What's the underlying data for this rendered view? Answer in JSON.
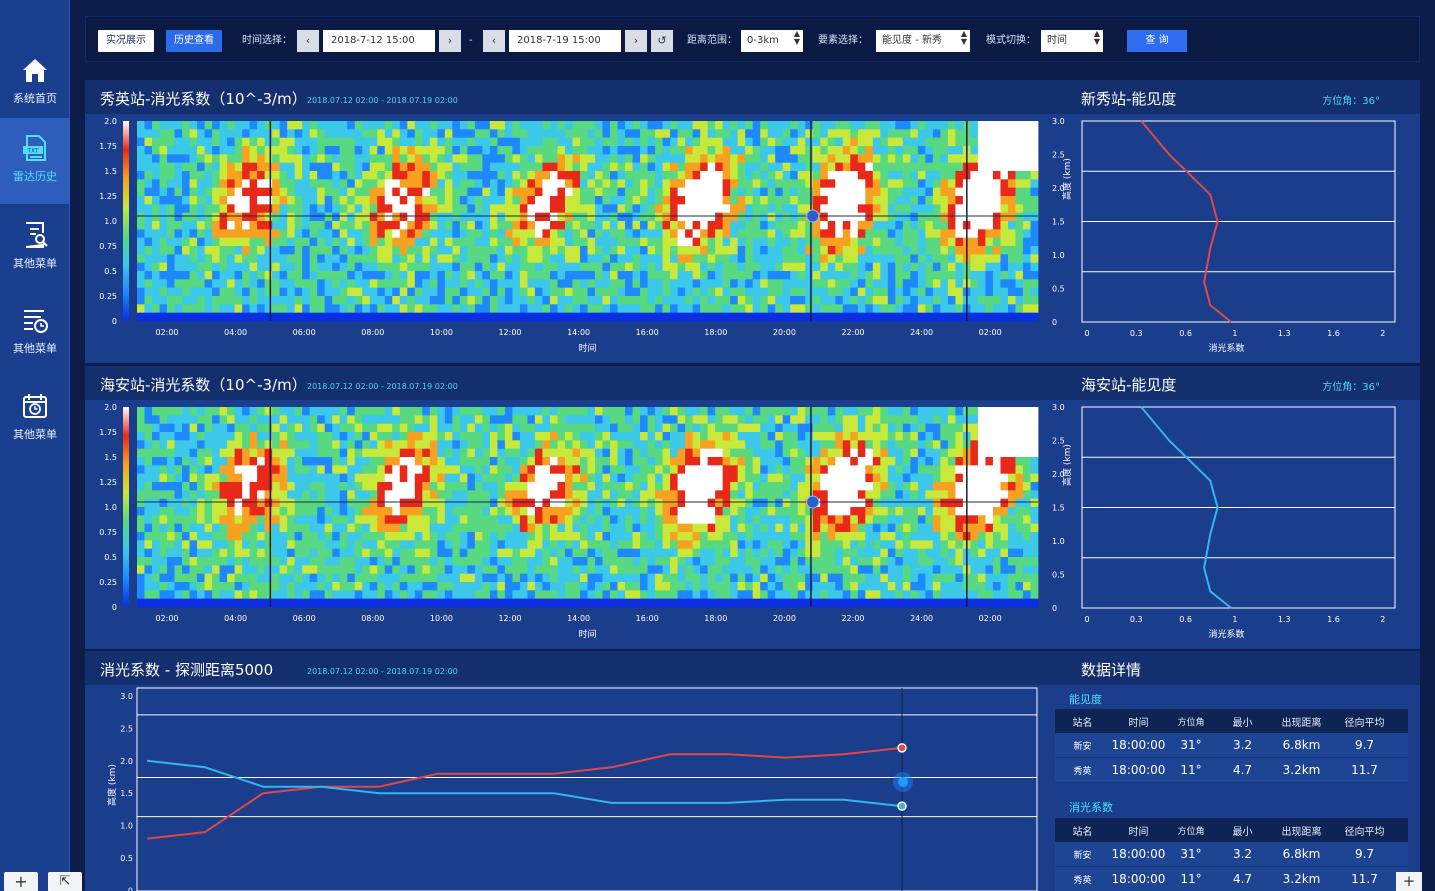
{
  "sidebar": {
    "items": [
      {
        "label": "系统首页",
        "icon": "home-icon"
      },
      {
        "label": "雷达历史",
        "icon": "txt-doc-icon"
      },
      {
        "label": "其他菜单",
        "icon": "doc-search-icon"
      },
      {
        "label": "其他菜单",
        "icon": "list-clock-icon"
      },
      {
        "label": "其他菜单",
        "icon": "calendar-clock-icon"
      }
    ],
    "active_index": 1,
    "bottom_plus": "+",
    "bottom_share": "⇱"
  },
  "toolbar": {
    "tab_live": "实况展示",
    "tab_history": "历史查看",
    "time_label": "时间选择：",
    "start_time": "2018-7-12 15:00",
    "dash": "-",
    "end_time": "2018-7-19 15:00",
    "range_label": "距离范围：",
    "range_value": "0-3km",
    "element_label": "要素选择：",
    "element_value": "能见度 - 新秀",
    "mode_label": "模式切换：",
    "mode_value": "时间",
    "query_button": "查 询",
    "prev": "‹",
    "next": "›",
    "reset": "↺"
  },
  "panel1": {
    "title": "秀英站-消光系数（10^-3/m）",
    "subtitle": "2018.07.12 02:00 - 2018.07.19 02:00"
  },
  "panel2": {
    "title": "海安站-消光系数（10^-3/m）",
    "subtitle": "2018.07.12 02:00 - 2018.07.19 02:00"
  },
  "side1": {
    "title": "新秀站-能见度",
    "azimuth": "方位角：36°"
  },
  "side2": {
    "title": "海安站-能见度",
    "azimuth": "方位角：36°"
  },
  "panel3": {
    "title": "消光系数 - 探测距离5000",
    "subtitle": "2018.07.12 02:00 - 2018.07.19 02:00"
  },
  "details": {
    "title": "数据详情",
    "section1": "能见度",
    "section2": "消光系数",
    "headers": [
      "站名",
      "时间",
      "方位角",
      "最小",
      "出现距离",
      "径向平均"
    ],
    "rows": [
      [
        "新安",
        "18:00:00",
        "31°",
        "3.2",
        "6.8km",
        "9.7"
      ],
      [
        "秀英",
        "18:00:00",
        "11°",
        "4.7",
        "3.2km",
        "11.7"
      ]
    ]
  },
  "bottom_plus_right": "+",
  "chart_data": [
    {
      "type": "heatmap",
      "title": "秀英站-消光系数（10^-3/m）",
      "xlabel": "时间",
      "ylabel": "",
      "x_ticks": [
        "02:00",
        "04:00",
        "06:00",
        "08:00",
        "10:00",
        "12:00",
        "14:00",
        "16:00",
        "18:00",
        "20:00",
        "22:00",
        "24:00",
        "02:00"
      ],
      "y_ticks": [
        "0",
        "0.25",
        "0.5",
        "0.75",
        "1.0",
        "1.25",
        "1.5",
        "1.75",
        "2.0"
      ],
      "colors": [
        "#0a2ee0",
        "#1e88ff",
        "#3cc8e8",
        "#58d880",
        "#c8e83a",
        "#f8a020",
        "#e82818",
        "#ffffff"
      ]
    },
    {
      "type": "heatmap",
      "title": "海安站-消光系数（10^-3/m）",
      "xlabel": "时间",
      "ylabel": "",
      "x_ticks": [
        "02:00",
        "04:00",
        "06:00",
        "08:00",
        "10:00",
        "12:00",
        "14:00",
        "16:00",
        "18:00",
        "20:00",
        "22:00",
        "24:00",
        "02:00"
      ],
      "y_ticks": [
        "0",
        "0.25",
        "0.5",
        "0.75",
        "1.0",
        "1.25",
        "1.5",
        "1.75",
        "2.0"
      ],
      "colors": [
        "#0a2ee0",
        "#1e88ff",
        "#3cc8e8",
        "#58d880",
        "#c8e83a",
        "#f8a020",
        "#e82818",
        "#ffffff"
      ]
    },
    {
      "type": "line",
      "title": "新秀站-能见度",
      "xlabel": "消光系数",
      "ylabel": "高度 (km)",
      "x_ticks": [
        "0",
        "0.3",
        "0.6",
        "1",
        "1.3",
        "1.6",
        "2"
      ],
      "y_ticks": [
        "0",
        "0.5",
        "1.0",
        "1.5",
        "2.0",
        "2.5",
        "3.0"
      ],
      "xlim": [
        0,
        2
      ],
      "ylim": [
        0,
        3.0
      ],
      "series": [
        {
          "color": "#e04848",
          "x": [
            0.97,
            0.8,
            0.75,
            0.8,
            0.86,
            0.8,
            0.5,
            0.33
          ],
          "y": [
            0,
            0.25,
            0.6,
            1.1,
            1.5,
            1.9,
            2.5,
            3.0
          ]
        }
      ]
    },
    {
      "type": "line",
      "title": "海安站-能见度",
      "xlabel": "消光系数",
      "ylabel": "高度 (km)",
      "x_ticks": [
        "0",
        "0.3",
        "0.6",
        "1",
        "1.3",
        "1.6",
        "2"
      ],
      "y_ticks": [
        "0",
        "0.5",
        "1.0",
        "1.5",
        "2.0",
        "2.5",
        "3.0"
      ],
      "xlim": [
        0,
        2
      ],
      "ylim": [
        0,
        3.0
      ],
      "series": [
        {
          "color": "#36b4ee",
          "x": [
            0.97,
            0.8,
            0.75,
            0.8,
            0.86,
            0.8,
            0.5,
            0.33
          ],
          "y": [
            0,
            0.25,
            0.6,
            1.1,
            1.5,
            1.9,
            2.5,
            3.0
          ]
        }
      ]
    },
    {
      "type": "line",
      "title": "消光系数 - 探测距离5000",
      "ylabel": "高度 (km)",
      "y_ticks": [
        "0",
        "0.5",
        "1.0",
        "1.5",
        "2.0",
        "2.5",
        "3.0"
      ],
      "ylim": [
        0,
        3.0
      ],
      "series": [
        {
          "color": "#e04848",
          "values": [
            0.8,
            0.9,
            1.5,
            1.6,
            1.6,
            1.8,
            1.8,
            1.8,
            1.9,
            2.1,
            2.1,
            2.05,
            2.1,
            2.2
          ]
        },
        {
          "color": "#36b4ee",
          "values": [
            2.0,
            1.9,
            1.6,
            1.6,
            1.5,
            1.5,
            1.5,
            1.5,
            1.35,
            1.35,
            1.35,
            1.4,
            1.4,
            1.3
          ]
        }
      ]
    }
  ]
}
